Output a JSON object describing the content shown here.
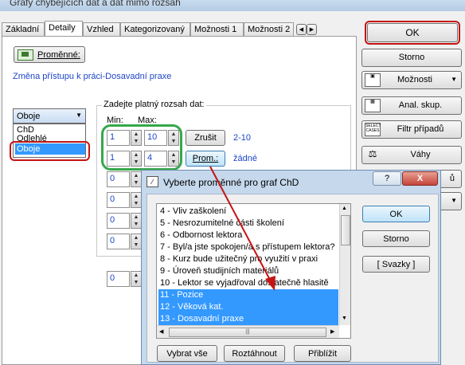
{
  "window": {
    "title": "Grafy chybějících dat a dat mimo rozsah"
  },
  "tabs": [
    "Základní",
    "Detaily",
    "Vzhled",
    "Kategorizovaný",
    "Možnosti 1",
    "Možnosti 2"
  ],
  "panel": {
    "variables_button": "Proměnné:",
    "variable_link": "Změna přístupu k práci-Dosavadní praxe",
    "mode_select": {
      "value": "Oboje",
      "options": [
        "ChD",
        "Odlehlé",
        "Oboje"
      ]
    },
    "range_group": {
      "title": "Zadejte platný rozsah dat:",
      "min_label": "Min:",
      "max_label": "Max:",
      "rows": [
        {
          "min": "1",
          "max": "10",
          "action": "Zrušit",
          "info": "2-10"
        },
        {
          "min": "1",
          "max": "4",
          "action": "Prom.:",
          "info": "žádné"
        },
        {
          "min": "0"
        },
        {
          "min": "0"
        },
        {
          "min": "0"
        },
        {
          "min": "0"
        },
        {
          "min": "0"
        }
      ]
    }
  },
  "right_buttons": {
    "ok": "OK",
    "cancel": "Storno",
    "options": "Možnosti",
    "group": "Anal. skup.",
    "filter": "Filtr případů",
    "weights": "Váhy",
    "partial": "ů"
  },
  "dialog": {
    "title": "Vyberte proměnné pro graf ChD",
    "help": "?",
    "close": "X",
    "items": [
      {
        "text": "4 - Vliv zaškolení",
        "selected": false
      },
      {
        "text": "5 - Nesrozumitelné části školení",
        "selected": false
      },
      {
        "text": "6 - Odbornost lektora",
        "selected": false
      },
      {
        "text": "7 - Byl/a jste spokojen/a s přístupem lektora?",
        "selected": false
      },
      {
        "text": "8 - Kurz bude užitečný pro využití v praxi",
        "selected": false
      },
      {
        "text": "9 - Úroveň studijních materiálů",
        "selected": false
      },
      {
        "text": "10 - Lektor se vyjadřoval dostatečně hlasitě",
        "selected": false
      },
      {
        "text": "11 - Pozice",
        "selected": true
      },
      {
        "text": "12 - Věková kat.",
        "selected": true
      },
      {
        "text": "13 - Dosavadní praxe",
        "selected": true
      }
    ],
    "ok": "OK",
    "cancel": "Storno",
    "links": "[ Svazky ]",
    "select_all": "Vybrat vše",
    "expand": "Roztáhnout",
    "zoom": "Přiblížit"
  },
  "colors": {
    "annotation_red": "#c41414",
    "annotation_green": "#35a84a",
    "selection": "#3399ff",
    "link": "#1d46c8"
  }
}
